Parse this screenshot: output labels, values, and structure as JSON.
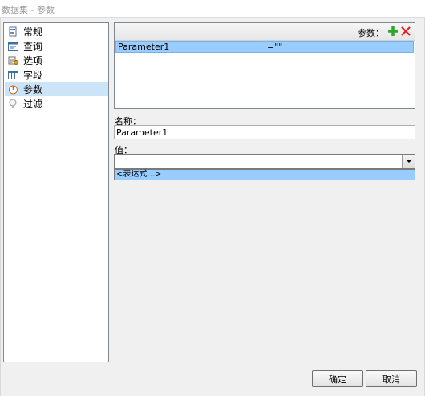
{
  "window": {
    "title": "数据集 - 参数"
  },
  "nav": {
    "items": [
      {
        "label": "常规",
        "icon": "general-icon"
      },
      {
        "label": "查询",
        "icon": "query-icon"
      },
      {
        "label": "选项",
        "icon": "options-icon"
      },
      {
        "label": "字段",
        "icon": "fields-icon"
      },
      {
        "label": "参数",
        "icon": "parameters-icon",
        "selected": true
      },
      {
        "label": "过滤",
        "icon": "filter-icon"
      }
    ]
  },
  "parameters": {
    "header_label": "参数：",
    "rows": [
      {
        "name": "Parameter1",
        "value": "=\"\""
      }
    ]
  },
  "form": {
    "name_label": "名称：",
    "name_value": "Parameter1",
    "value_label": "值：",
    "value_value": "",
    "dropdown_options": [
      "<表达式...>"
    ]
  },
  "buttons": {
    "ok": "确定",
    "cancel": "取消"
  },
  "colors": {
    "selection": "#99ccff",
    "nav_selection": "#cce4f7",
    "add": "#2ea62e",
    "delete": "#e02020"
  }
}
